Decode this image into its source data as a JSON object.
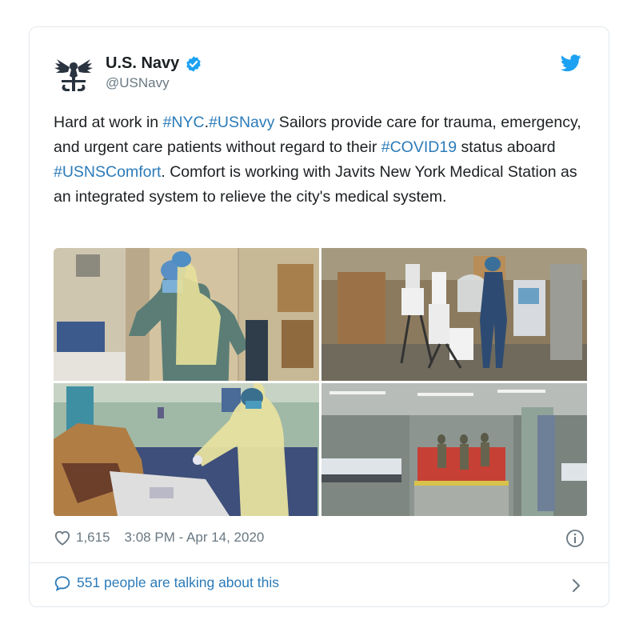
{
  "author": {
    "name": "U.S. Navy",
    "handle": "@USNavy",
    "avatar_icon": "navy-eagle-emblem-icon",
    "verified_icon": "verified-badge-icon"
  },
  "tweet": {
    "segments": [
      {
        "text": "Hard at work in ",
        "hashtag": false
      },
      {
        "text": "#NYC",
        "hashtag": true
      },
      {
        "text": ".",
        "hashtag": false
      },
      {
        "text": "#USNavy",
        "hashtag": true
      },
      {
        "text": " Sailors provide care for trauma, emergency, and urgent care patients without regard to their ",
        "hashtag": false
      },
      {
        "text": "#COVID19",
        "hashtag": true
      },
      {
        "text": " status aboard ",
        "hashtag": false
      },
      {
        "text": "#USNSComfort",
        "hashtag": true
      },
      {
        "text": ". Comfort is working with Javits New York Medical Station as an integrated system to relieve the city's medical system.",
        "hashtag": false
      }
    ]
  },
  "media": {
    "photos": [
      {
        "name": "photo-sailors-donning-ppe"
      },
      {
        "name": "photo-medical-equipment-room"
      },
      {
        "name": "photo-sailor-in-gown-at-counter"
      },
      {
        "name": "photo-ship-ward-corridor"
      }
    ]
  },
  "stats": {
    "likes": "1,615",
    "timestamp": "3:08 PM - Apr 14, 2020"
  },
  "footer": {
    "talking": "551 people are talking about this"
  },
  "colors": {
    "link": "#2b7bb9",
    "secondary_text": "#697882",
    "twitter_blue": "#1da1f2",
    "border": "#e1e8ed"
  }
}
